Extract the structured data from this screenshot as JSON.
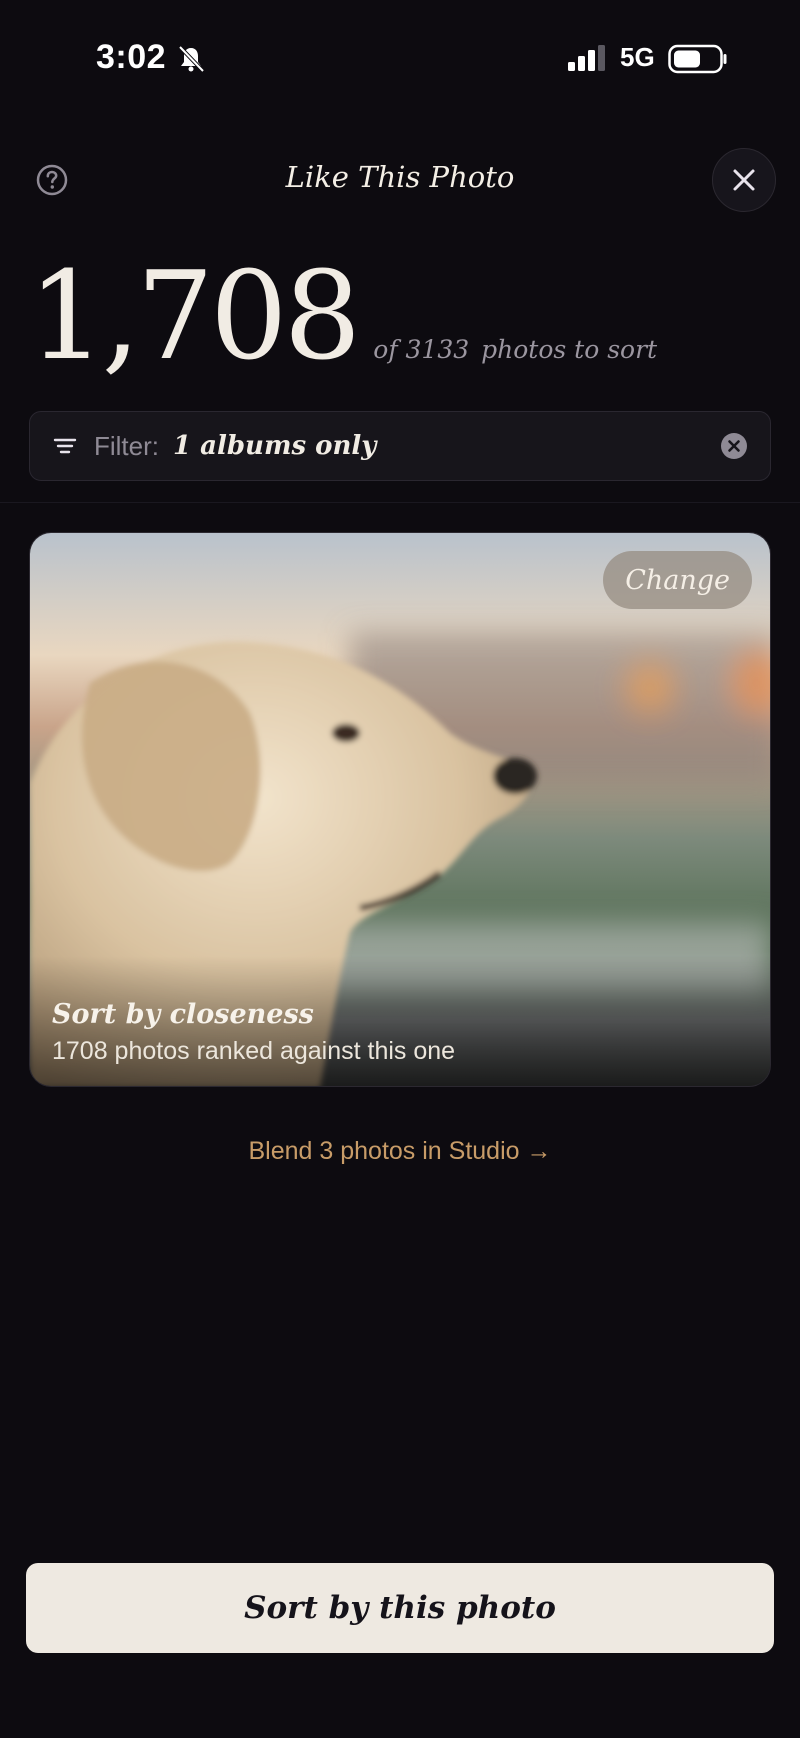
{
  "status_bar": {
    "time": "3:02",
    "network": "5G",
    "icons": [
      "bell-muted-icon",
      "signal-icon",
      "battery-icon"
    ]
  },
  "header": {
    "title": "Like This Photo",
    "help_icon": "help-circle-icon",
    "close_icon": "close-icon"
  },
  "counter": {
    "count": "1,708",
    "of_text": "of 3133",
    "suffix": "photos to sort"
  },
  "filter": {
    "label": "Filter:",
    "value": "1 albums only",
    "icon": "filter-lines-icon",
    "clear_icon": "clear-circle-icon"
  },
  "photo_card": {
    "change_label": "Change",
    "title": "Sort by closeness",
    "subtitle": "1708 photos ranked against this one"
  },
  "blend_link": {
    "label": "Blend 3 photos in Studio →"
  },
  "primary_button": {
    "label": "Sort by this photo"
  },
  "colors": {
    "background": "#0d0b10",
    "accent": "#c89c68",
    "button_bg": "#eee9e1"
  }
}
